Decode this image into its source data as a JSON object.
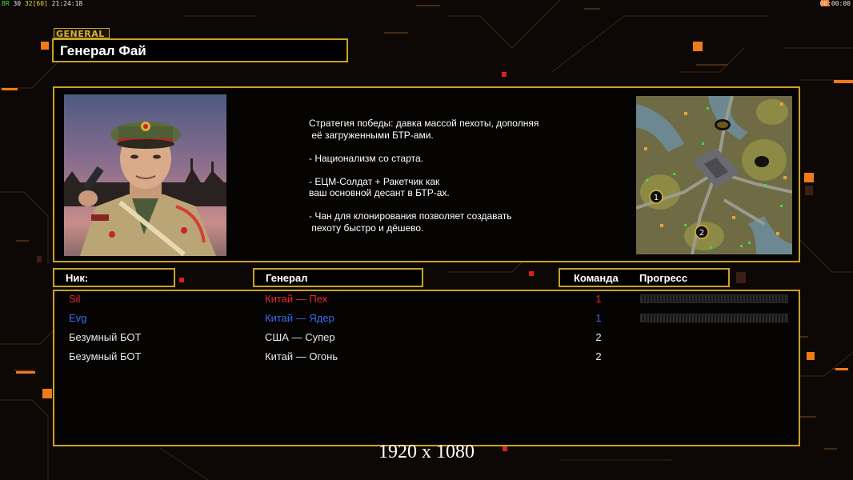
{
  "hud": {
    "left_a": "BR",
    "left_b": "30",
    "left_c": "32",
    "left_d": "[60]",
    "left_time": "21:24:18",
    "right_time": "00:00:00"
  },
  "general": {
    "tag": "GENERAL",
    "name": "Генерал Фай",
    "description": "Стратегия победы: давка массой пехоты, дополняя\n её загруженными БТР-ами.\n\n- Национализм со старта.\n\n- ЕЦМ-Солдат + Ракетчик как\nваш основной десант в БТР-ах.\n\n- Чан для клонирования позволяет создавать\n пехоту быстро и дёшево."
  },
  "minimap": {
    "start_1": "1",
    "start_2": "2"
  },
  "headers": {
    "nick": "Ник:",
    "general": "Генерал",
    "team": "Команда",
    "progress": "Прогресс"
  },
  "players": [
    {
      "nick": "Sil",
      "general": "Китай — Пех",
      "team": "1",
      "color": "#e82a2a",
      "show_progress": true
    },
    {
      "nick": "Evg",
      "general": "Китай — Ядер",
      "team": "1",
      "color": "#3a6cf0",
      "show_progress": true
    },
    {
      "nick": "Безумный БОТ",
      "general": "США — Супер",
      "team": "2",
      "color": "#e8e8e8",
      "show_progress": false
    },
    {
      "nick": "Безумный БОТ",
      "general": "Китай — Огонь",
      "team": "2",
      "color": "#e8e8e8",
      "show_progress": false
    }
  ],
  "footer": {
    "resolution": "1920 x 1080"
  },
  "colors": {
    "frame": "#c9a227",
    "accent_orange": "#f07a1a"
  }
}
